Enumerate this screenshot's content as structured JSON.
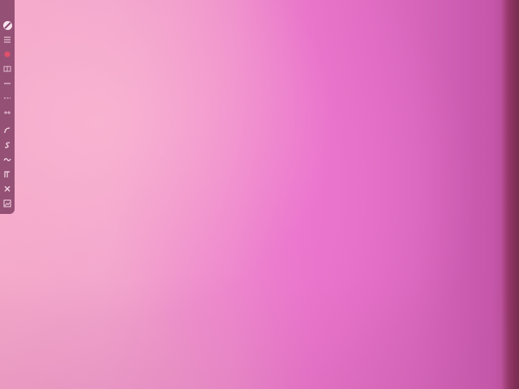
{
  "canvas": {
    "colors": {
      "left": "#f3a7c8",
      "center": "#ee8fcb",
      "right": "#c556aa",
      "edge": "#8c325f"
    }
  },
  "toolbar": {
    "tools": [
      {
        "icon": "no-entry-icon"
      },
      {
        "icon": "menu-icon"
      },
      {
        "icon": "record-dot-icon"
      },
      {
        "icon": "grid-icon"
      },
      {
        "icon": "line-icon"
      },
      {
        "icon": "dash-icon"
      },
      {
        "icon": "ruler-icon"
      },
      {
        "icon": "curve-icon"
      },
      {
        "icon": "s-curve-icon"
      },
      {
        "icon": "wave-icon"
      },
      {
        "icon": "branch-icon"
      },
      {
        "icon": "cross-icon"
      },
      {
        "icon": "image-icon"
      }
    ],
    "colors": {
      "bg": "#8c486e",
      "icon": "#f6d8e6",
      "accent": "#e0506a"
    }
  }
}
